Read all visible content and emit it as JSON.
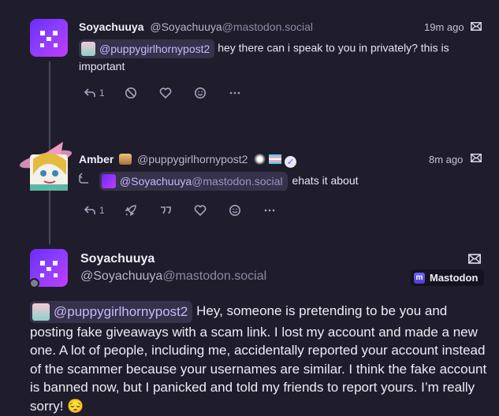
{
  "thread": {
    "posts": [
      {
        "display_name": "Soyachuuya",
        "handle_user": "@Soyachuuya",
        "handle_domain": "@mastodon.social",
        "time": "19m ago",
        "mention": "@puppygirlhornypost2",
        "text": "hey there can i speak to you in privately? this is important",
        "reply_count": "1"
      },
      {
        "display_name": "Amber",
        "handle_user": "@puppygirlhornypost2",
        "time": "8m ago",
        "mention_user": "@Soyachuuya",
        "mention_domain": "@mastodon.social",
        "text": "ehats it about",
        "reply_count": "1"
      }
    ],
    "focused": {
      "display_name": "Soyachuuya",
      "handle_user": "@Soyachuuya",
      "handle_domain": "@mastodon.social",
      "instance_badge": "Mastodon",
      "mention": "@puppygirlhornypost2",
      "text": "Hey, someone is pretending to be you and posting fake giveaways with a scam link. I lost my account and made a new one. A lot of people, including me, accidentally reported your account instead of the scammer because your usernames are similar. I think the fake account is banned now, but I panicked and told my friends to report yours. I’m really sorry!",
      "emoji": "😔"
    }
  },
  "colors": {
    "background": "#1f1d2b",
    "accent": "#8b3dff",
    "mention_bg": "#35324a",
    "mention_text": "#c7b8ff"
  }
}
